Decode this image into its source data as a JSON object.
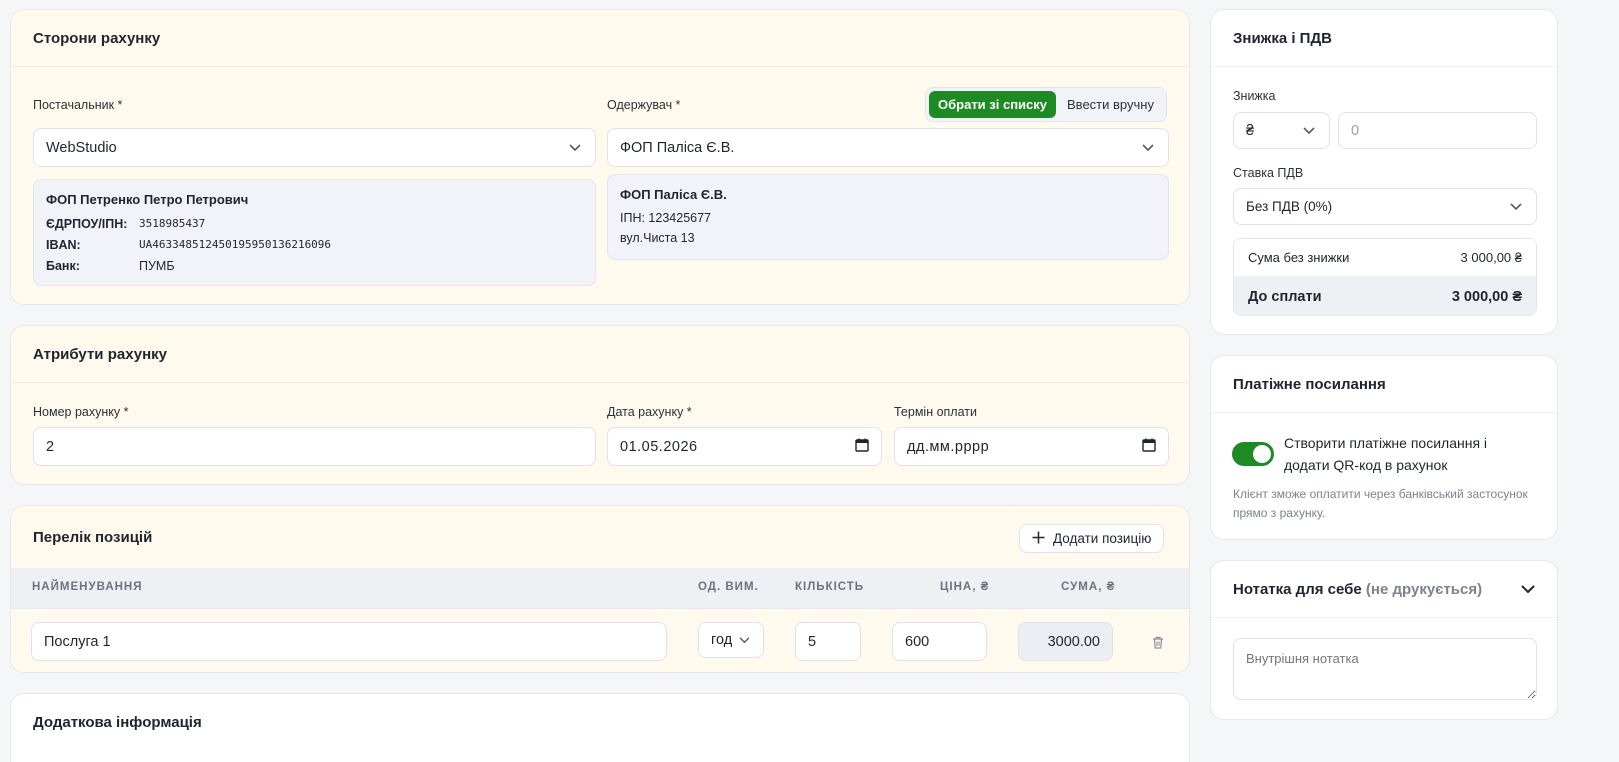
{
  "parties": {
    "title": "Сторони рахунку",
    "supplier_label": "Постачальник *",
    "supplier_value": "WebStudio",
    "supplier_info": {
      "name": "ФОП Петренко Петро Петрович",
      "edrpou_key": "ЄДРПОУ/ІПН:",
      "edrpou_val": "3518985437",
      "iban_key": "IBAN:",
      "iban_val": "UA463348512450195950136216096",
      "bank_key": "Банк:",
      "bank_val": "ПУМБ"
    },
    "recipient_label": "Одержувач *",
    "mode_list": "Обрати зі списку",
    "mode_manual": "Ввести вручну",
    "recipient_value": "ФОП Паліса Є.В.",
    "recipient_info": {
      "name": "ФОП Паліса Є.В.",
      "ipn": "ІПН: 123425677",
      "address": "вул.Чиста 13"
    }
  },
  "attributes": {
    "title": "Атрибути рахунку",
    "number_label": "Номер рахунку *",
    "number_value": "2",
    "date_label": "Дата рахунку *",
    "date_value": "01.05.2026",
    "due_label": "Термін оплати",
    "due_value": "дд.мм.рррр"
  },
  "items": {
    "title": "Перелік позицій",
    "add_button": "Додати позицію",
    "columns": {
      "name": "НАЙМЕНУВАННЯ",
      "unit": "ОД. ВИМ.",
      "qty": "КІЛЬКІСТЬ",
      "price": "ЦІНА, ₴",
      "sum": "СУМА, ₴"
    },
    "rows": [
      {
        "name": "Послуга 1",
        "unit": "год",
        "qty": "5",
        "price": "600",
        "sum": "3000.00"
      }
    ]
  },
  "additional": {
    "title": "Додаткова інформація"
  },
  "discount": {
    "title": "Знижка і ПДВ",
    "discount_label": "Знижка",
    "currency": "₴",
    "discount_placeholder": "0",
    "vat_label": "Ставка ПДВ",
    "vat_value": "Без ПДВ (0%)",
    "subtotal_label": "Сума без знижки",
    "subtotal_value": "3 000,00 ₴",
    "total_label": "До сплати",
    "total_value": "3 000,00 ₴"
  },
  "payment_link": {
    "title": "Платіжне посилання",
    "toggle_label": "Створити платіжне посилання і додати QR-код в рахунок",
    "enabled": true,
    "hint": "Клієнт зможе оплатити через банківський застосунок прямо з рахунку."
  },
  "note": {
    "title": "Нотатка для себе",
    "title_suffix": "(не друкується)",
    "placeholder": "Внутрішня нотатка"
  },
  "colors": {
    "accent": "#1e8a24",
    "cream": "#fffaed"
  }
}
